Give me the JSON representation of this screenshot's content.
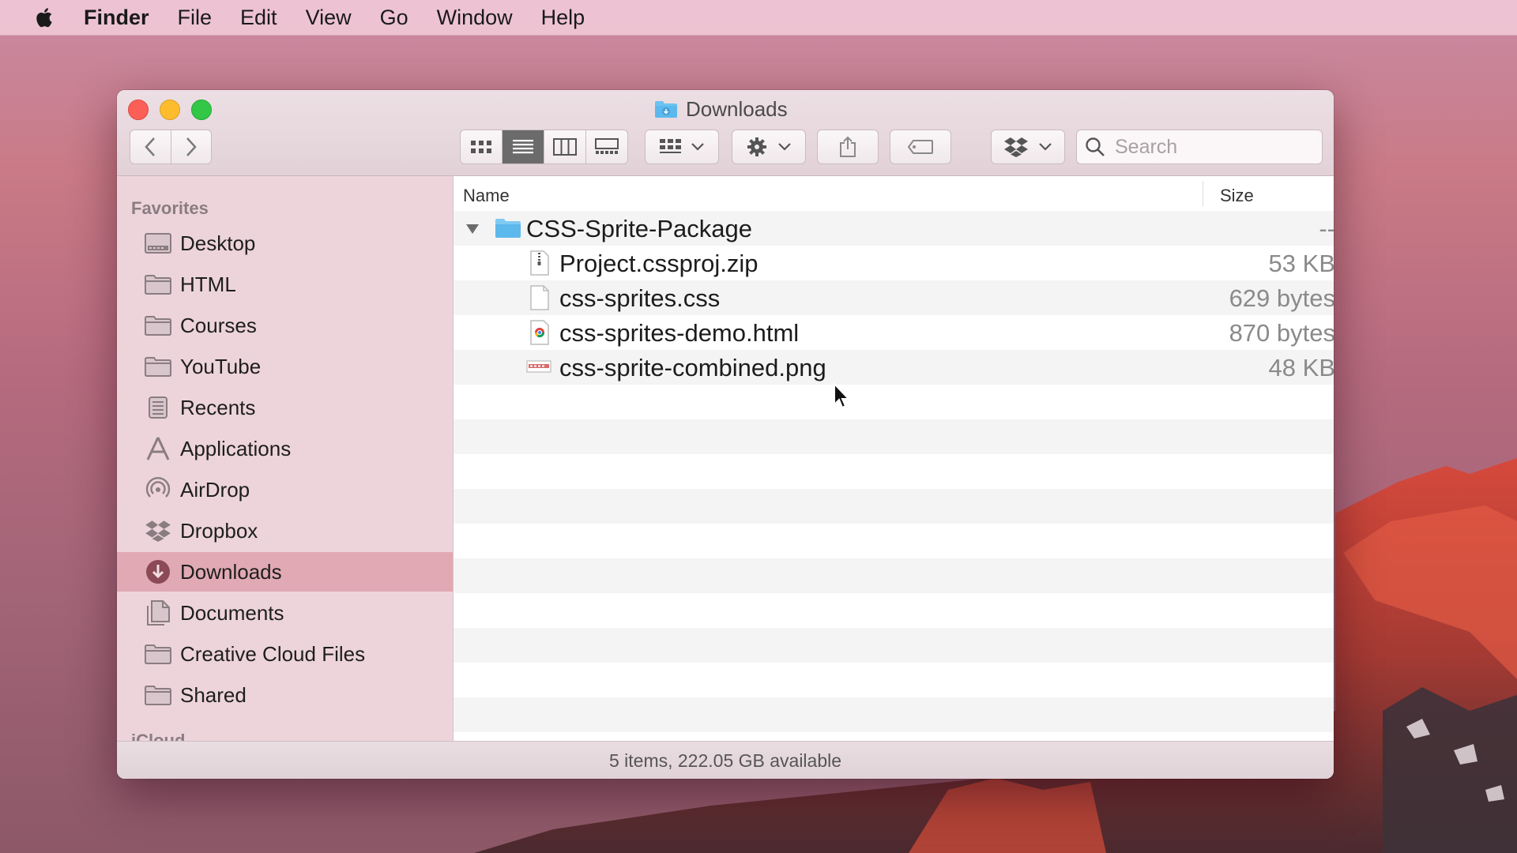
{
  "menubar": {
    "app": "Finder",
    "items": [
      "File",
      "Edit",
      "View",
      "Go",
      "Window",
      "Help"
    ]
  },
  "window": {
    "title": "Downloads",
    "search_placeholder": "Search"
  },
  "sidebar": {
    "section_favorites": "Favorites",
    "section_icloud": "iCloud",
    "items": [
      {
        "label": "Desktop",
        "icon": "desktop-icon"
      },
      {
        "label": "HTML",
        "icon": "folder-icon"
      },
      {
        "label": "Courses",
        "icon": "folder-icon"
      },
      {
        "label": "YouTube",
        "icon": "folder-icon"
      },
      {
        "label": "Recents",
        "icon": "recents-icon"
      },
      {
        "label": "Applications",
        "icon": "applications-icon"
      },
      {
        "label": "AirDrop",
        "icon": "airdrop-icon"
      },
      {
        "label": "Dropbox",
        "icon": "dropbox-icon"
      },
      {
        "label": "Downloads",
        "icon": "downloads-icon",
        "selected": true
      },
      {
        "label": "Documents",
        "icon": "documents-icon"
      },
      {
        "label": "Creative Cloud Files",
        "icon": "folder-icon"
      },
      {
        "label": "Shared",
        "icon": "folder-icon"
      }
    ]
  },
  "list": {
    "columns": {
      "name": "Name",
      "size": "Size"
    },
    "rows": [
      {
        "name": "CSS-Sprite-Package",
        "size": "--",
        "kind": "folder",
        "expanded": true
      },
      {
        "name": "Project.cssproj.zip",
        "size": "53 KB",
        "kind": "zip"
      },
      {
        "name": "css-sprites.css",
        "size": "629 bytes",
        "kind": "css"
      },
      {
        "name": "css-sprites-demo.html",
        "size": "870 bytes",
        "kind": "html"
      },
      {
        "name": "css-sprite-combined.png",
        "size": "48 KB",
        "kind": "png"
      }
    ]
  },
  "status": "5 items, 222.05 GB available",
  "colors": {
    "selection": "#e0a9b3",
    "folder_blue": "#5db8ec",
    "close": "#fc5f57",
    "minimize": "#fdbc2e",
    "zoom": "#33c748"
  }
}
